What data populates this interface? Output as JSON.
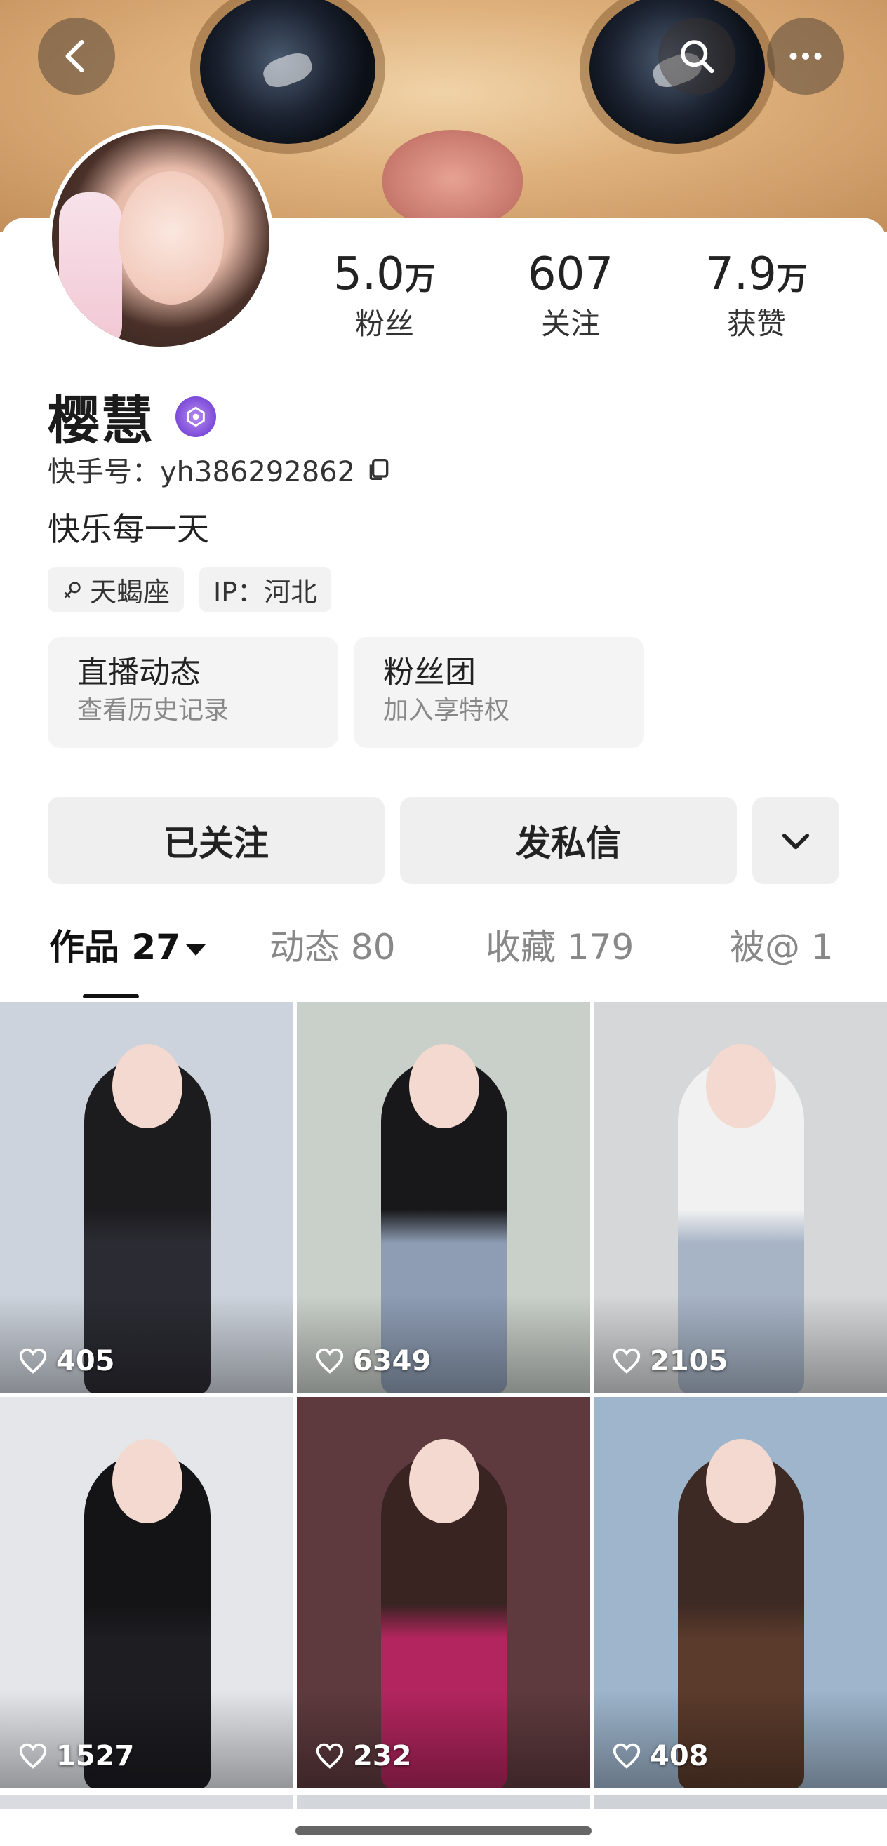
{
  "profile": {
    "name": "樱慧",
    "kuaishou_id": "快手号：yh386292862",
    "bio": "快乐每一天",
    "tags": [
      "天蝎座",
      "IP：河北"
    ]
  },
  "stats": [
    {
      "num": "5.0",
      "unit": "万",
      "label": "粉丝"
    },
    {
      "num": "607",
      "unit": "",
      "label": "关注"
    },
    {
      "num": "7.9",
      "unit": "万",
      "label": "获赞"
    }
  ],
  "boxes": [
    {
      "title": "直播动态",
      "subtitle": "查看历史记录"
    },
    {
      "title": "粉丝团",
      "subtitle": "加入享特权"
    }
  ],
  "actions": {
    "follow": "已关注",
    "message": "发私信"
  },
  "tabs": [
    "作品 27",
    "动态 80",
    "收藏 179",
    "被@ 1"
  ],
  "videos": [
    {
      "likes": "405",
      "bg": "#cdd3dc",
      "top": "#1c1c1f",
      "bottom": "#2b2b33"
    },
    {
      "likes": "6349",
      "bg": "#c9cfc9",
      "top": "#18181b",
      "bottom": "#8e9db4"
    },
    {
      "likes": "2105",
      "bg": "#d5d7d8",
      "top": "#f1f1f1",
      "bottom": "#a7b4c6"
    },
    {
      "likes": "1527",
      "bg": "#e4e6ea",
      "top": "#141416",
      "bottom": "#1d1d22"
    },
    {
      "likes": "232",
      "bg": "#5e3a3e",
      "top": "#3a2422",
      "bottom": "#b3255e"
    },
    {
      "likes": "408",
      "bg": "#9eb5cc",
      "top": "#3e2a24",
      "bottom": "#5b3b2c"
    }
  ],
  "icons": {
    "back": "back-arrow-icon",
    "search": "search-icon",
    "more": "more-dots-icon",
    "copy": "copy-icon",
    "zodiac": "female-symbol-icon",
    "dropdown": "chevron-down-icon",
    "like": "heart-icon"
  }
}
